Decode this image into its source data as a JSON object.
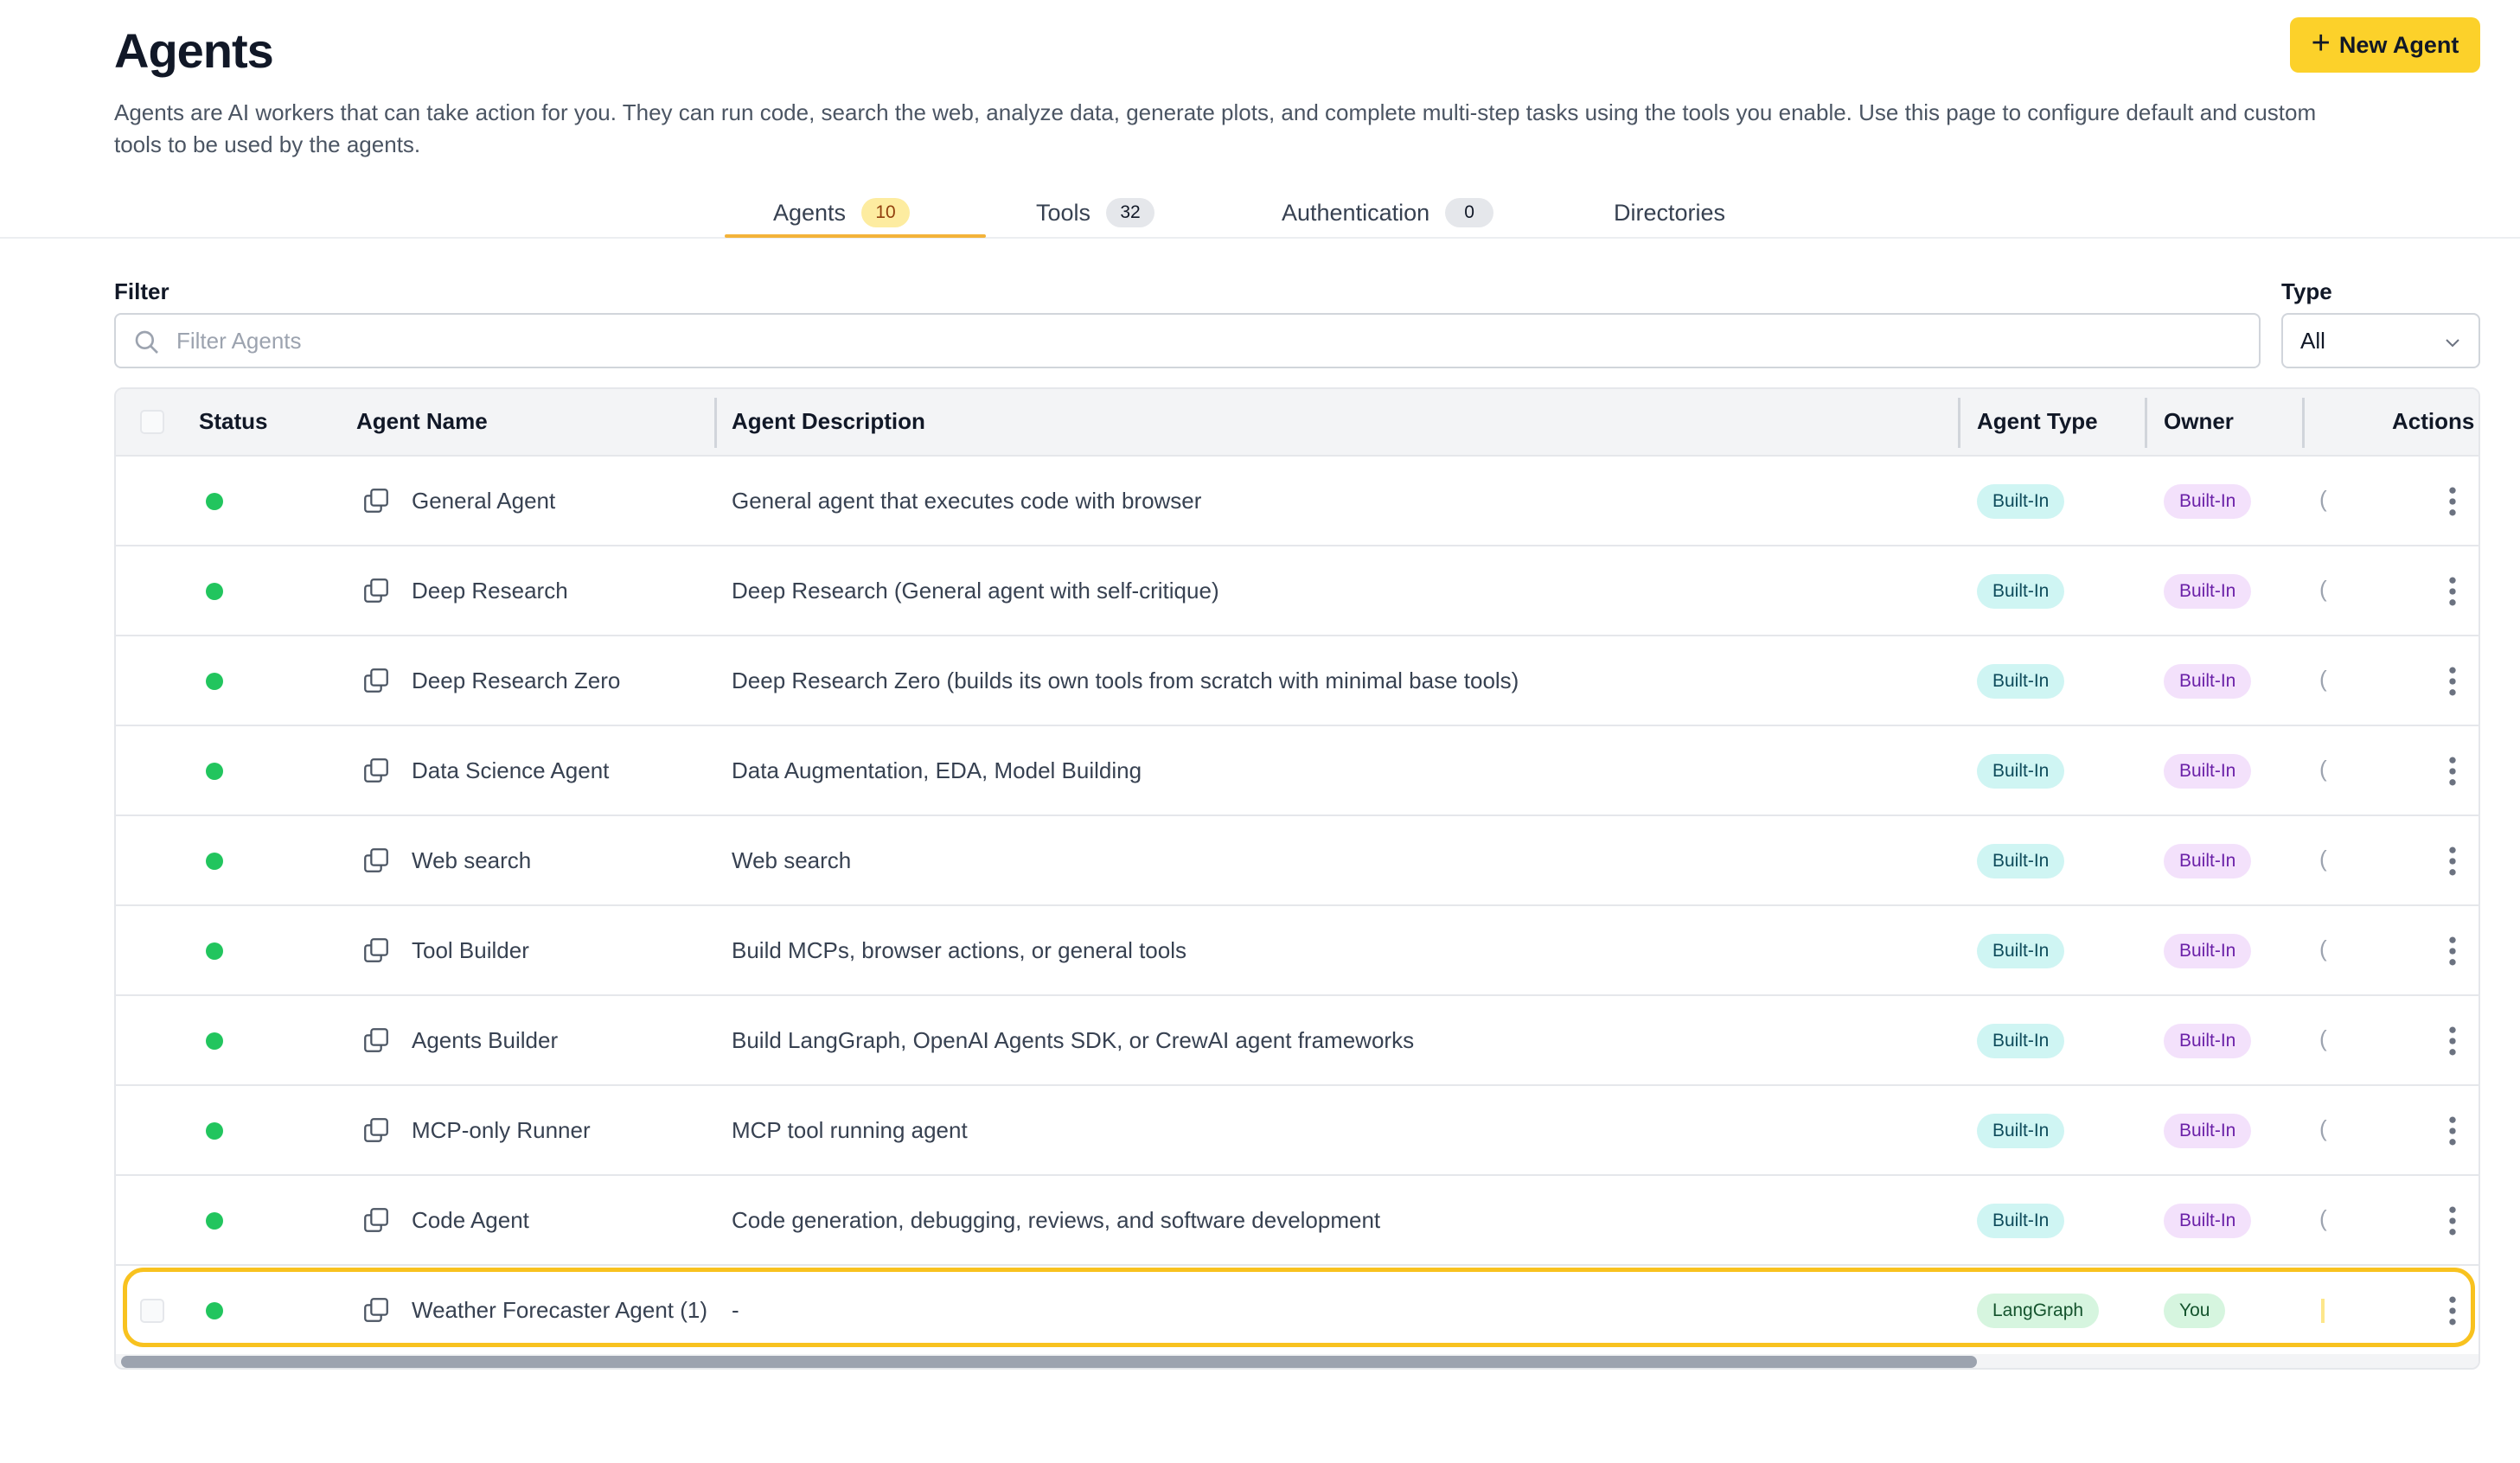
{
  "page": {
    "title": "Agents",
    "description": "Agents are AI workers that can take action for you. They can run code, search the web, analyze data, generate plots, and complete multi-step tasks using the tools you enable. Use this page to configure default and custom tools to be used by the agents.",
    "new_agent_label": "New Agent"
  },
  "tabs": [
    {
      "label": "Agents",
      "count": "10"
    },
    {
      "label": "Tools",
      "count": "32"
    },
    {
      "label": "Authentication",
      "count": "0"
    },
    {
      "label": "Directories"
    }
  ],
  "filter": {
    "label": "Filter",
    "placeholder": "Filter Agents",
    "type_label": "Type",
    "type_value": "All"
  },
  "table": {
    "columns": [
      "Status",
      "Agent Name",
      "Agent Description",
      "Agent Type",
      "Owner",
      "Actions"
    ],
    "rows": [
      {
        "name": "General Agent",
        "description": "General agent that executes code with browser",
        "type": "Built-In",
        "owner": "Built-In"
      },
      {
        "name": "Deep Research",
        "description": "Deep Research (General agent with self-critique)",
        "type": "Built-In",
        "owner": "Built-In"
      },
      {
        "name": "Deep Research Zero",
        "description": "Deep Research Zero (builds its own tools from scratch with minimal base tools)",
        "type": "Built-In",
        "owner": "Built-In"
      },
      {
        "name": "Data Science Agent",
        "description": "Data Augmentation, EDA, Model Building",
        "type": "Built-In",
        "owner": "Built-In"
      },
      {
        "name": "Web search",
        "description": "Web search",
        "type": "Built-In",
        "owner": "Built-In"
      },
      {
        "name": "Tool Builder",
        "description": "Build MCPs, browser actions, or general tools",
        "type": "Built-In",
        "owner": "Built-In"
      },
      {
        "name": "Agents Builder",
        "description": "Build LangGraph, OpenAI Agents SDK, or CrewAI agent frameworks",
        "type": "Built-In",
        "owner": "Built-In"
      },
      {
        "name": "MCP-only Runner",
        "description": "MCP tool running agent",
        "type": "Built-In",
        "owner": "Built-In"
      },
      {
        "name": "Code Agent",
        "description": "Code generation, debugging, reviews, and software development",
        "type": "Built-In",
        "owner": "Built-In"
      },
      {
        "name": "Weather Forecaster Agent (1)",
        "description": "-",
        "type": "LangGraph",
        "owner": "You"
      }
    ]
  },
  "colors": {
    "accent": "#fcd12a",
    "status_active": "#22c55e",
    "highlight": "#f8c21f"
  },
  "icons": {
    "new_agent": "plus-icon",
    "search": "search-icon",
    "type_select": "chevron-down-icon",
    "row_copy": "copy-icon",
    "row_actions": "kebab-menu-icon"
  }
}
